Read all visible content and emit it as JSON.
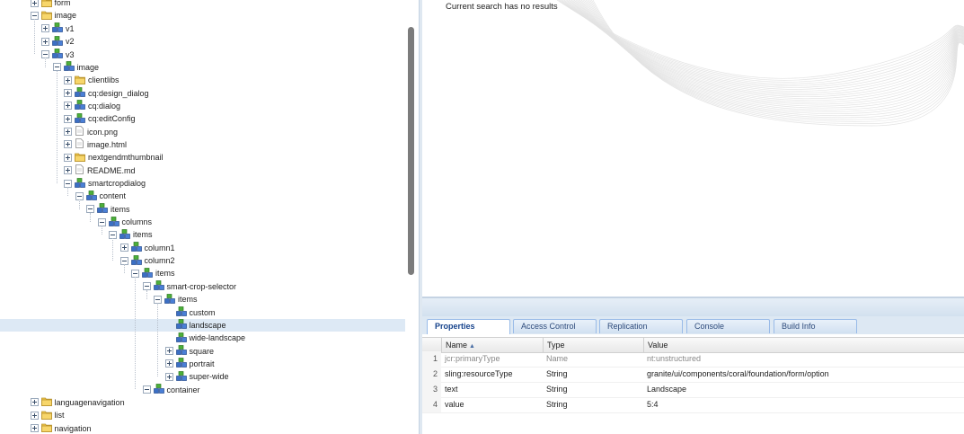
{
  "tree": {
    "rows": [
      {
        "label": "form",
        "level": 2,
        "toggle": "closed",
        "icon": "folder-icon"
      },
      {
        "label": "image",
        "level": 2,
        "toggle": "open",
        "icon": "folder-icon"
      },
      {
        "label": "v1",
        "level": 3,
        "toggle": "closed",
        "icon": "component-icon"
      },
      {
        "label": "v2",
        "level": 3,
        "toggle": "closed",
        "icon": "component-icon"
      },
      {
        "label": "v3",
        "level": 3,
        "toggle": "open",
        "icon": "component-icon"
      },
      {
        "label": "image",
        "level": 4,
        "toggle": "open",
        "icon": "component-icon"
      },
      {
        "label": "clientlibs",
        "level": 5,
        "toggle": "closed",
        "icon": "folder-icon"
      },
      {
        "label": "cq:design_dialog",
        "level": 5,
        "toggle": "closed",
        "icon": "component-icon"
      },
      {
        "label": "cq:dialog",
        "level": 5,
        "toggle": "closed",
        "icon": "component-icon"
      },
      {
        "label": "cq:editConfig",
        "level": 5,
        "toggle": "closed",
        "icon": "component-icon"
      },
      {
        "label": "icon.png",
        "level": 5,
        "toggle": "closed",
        "icon": "file-icon"
      },
      {
        "label": "image.html",
        "level": 5,
        "toggle": "closed",
        "icon": "file-icon"
      },
      {
        "label": "nextgendmthumbnail",
        "level": 5,
        "toggle": "closed",
        "icon": "folder-icon"
      },
      {
        "label": "README.md",
        "level": 5,
        "toggle": "closed",
        "icon": "file-icon"
      },
      {
        "label": "smartcropdialog",
        "level": 5,
        "toggle": "open",
        "icon": "component-icon"
      },
      {
        "label": "content",
        "level": 6,
        "toggle": "open",
        "icon": "component-icon"
      },
      {
        "label": "items",
        "level": 7,
        "toggle": "open",
        "icon": "component-icon"
      },
      {
        "label": "columns",
        "level": 8,
        "toggle": "open",
        "icon": "component-icon"
      },
      {
        "label": "items",
        "level": 9,
        "toggle": "open",
        "icon": "component-icon"
      },
      {
        "label": "column1",
        "level": 10,
        "toggle": "closed",
        "icon": "component-icon"
      },
      {
        "label": "column2",
        "level": 10,
        "toggle": "open",
        "icon": "component-icon"
      },
      {
        "label": "items",
        "level": 11,
        "toggle": "open",
        "icon": "component-icon"
      },
      {
        "label": "smart-crop-selector",
        "level": 12,
        "toggle": "open",
        "icon": "component-icon"
      },
      {
        "label": "items",
        "level": 13,
        "toggle": "open",
        "icon": "component-icon"
      },
      {
        "label": "custom",
        "level": 14,
        "toggle": "none",
        "icon": "component-icon"
      },
      {
        "label": "landscape",
        "level": 14,
        "toggle": "none",
        "icon": "component-icon",
        "selected": true
      },
      {
        "label": "wide-landscape",
        "level": 14,
        "toggle": "none",
        "icon": "component-icon"
      },
      {
        "label": "square",
        "level": 14,
        "toggle": "closed",
        "icon": "component-icon"
      },
      {
        "label": "portrait",
        "level": 14,
        "toggle": "closed",
        "icon": "component-icon"
      },
      {
        "label": "super-wide",
        "level": 14,
        "toggle": "closed",
        "icon": "component-icon"
      },
      {
        "label": "container",
        "level": 12,
        "toggle": "open",
        "icon": "component-icon"
      },
      {
        "label": "languagenavigation",
        "level": 2,
        "toggle": "closed",
        "icon": "folder-icon"
      },
      {
        "label": "list",
        "level": 2,
        "toggle": "closed",
        "icon": "folder-icon"
      },
      {
        "label": "navigation",
        "level": 2,
        "toggle": "closed",
        "icon": "folder-icon"
      }
    ]
  },
  "search": {
    "message": "Current search has no results"
  },
  "tabs": [
    {
      "label": "Properties",
      "active": true
    },
    {
      "label": "Access Control",
      "active": false
    },
    {
      "label": "Replication",
      "active": false
    },
    {
      "label": "Console",
      "active": false
    },
    {
      "label": "Build Info",
      "active": false
    }
  ],
  "grid": {
    "columns": {
      "name": "Name",
      "name_sort": "▲",
      "type": "Type",
      "value": "Value"
    },
    "rows": [
      {
        "num": "1",
        "name": "jcr:primaryType",
        "type": "Name",
        "value": "nt:unstructured",
        "protected": true
      },
      {
        "num": "2",
        "name": "sling:resourceType",
        "type": "String",
        "value": "granite/ui/components/coral/foundation/form/option",
        "protected": false
      },
      {
        "num": "3",
        "name": "text",
        "type": "String",
        "value": "Landscape",
        "protected": false
      },
      {
        "num": "4",
        "name": "value",
        "type": "String",
        "value": "5:4",
        "protected": false
      }
    ]
  },
  "colors": {
    "selection": "#dde9f5",
    "tab_text": "#15428b",
    "folder": "#f2c84b",
    "component_blue": "#3b6fc4",
    "component_green": "#4caf3a"
  }
}
